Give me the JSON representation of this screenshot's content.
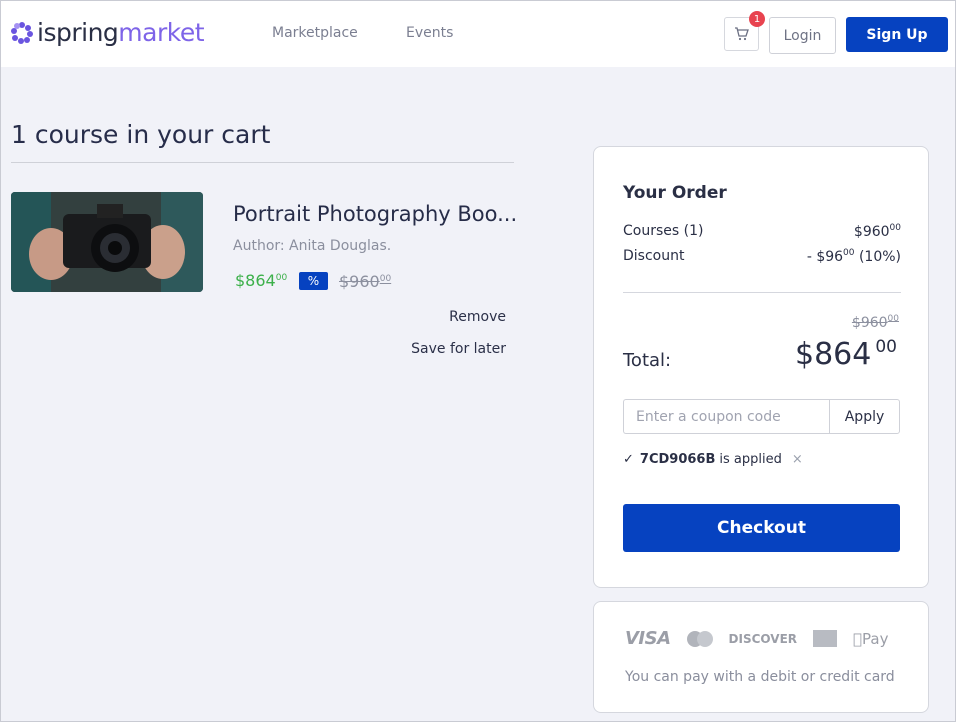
{
  "header": {
    "logo_left": "ispring",
    "logo_right": "market",
    "nav": [
      "Marketplace",
      "Events"
    ],
    "cart_count": "1",
    "login_label": "Login",
    "signup_label": "Sign Up"
  },
  "cart": {
    "title": "1 course in your cart",
    "items": [
      {
        "name": "Portrait Photography Boo...",
        "author": "Author: Anita Douglas.",
        "price": "$864",
        "price_cents": "00",
        "discount_badge": "%",
        "old_price": "$960",
        "old_price_cents": "00",
        "remove_label": "Remove",
        "save_label": "Save for later"
      }
    ]
  },
  "order": {
    "title": "Your Order",
    "courses_label": "Courses (1)",
    "courses_value": "$960",
    "courses_cents": "00",
    "discount_label": "Discount",
    "discount_value": "- $96",
    "discount_cents": "00",
    "discount_pct": "(10%)",
    "total_old": "$960",
    "total_old_cents": "00",
    "total_label": "Total:",
    "total_value": "$864",
    "total_cents": "00",
    "coupon_placeholder": "Enter a coupon code",
    "apply_label": "Apply",
    "applied_check": "✓",
    "applied_code": "7CD9066B",
    "applied_text": "is applied",
    "applied_remove": "×",
    "checkout_label": "Checkout"
  },
  "payment": {
    "logos": [
      "VISA",
      "mastercard-icon",
      "DISCOVER",
      "amex-icon",
      "Pay"
    ],
    "text": "You can pay with a debit or credit card"
  },
  "colors": {
    "brand_blue": "#0642c0",
    "brand_purple": "#7e64e8",
    "price_green": "#3cb04a",
    "badge_red": "#e8434f"
  }
}
